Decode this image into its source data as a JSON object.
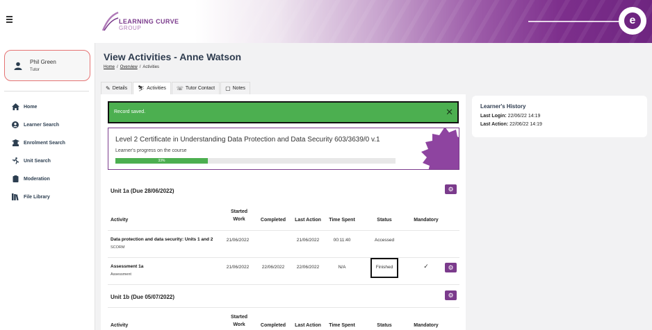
{
  "header": {
    "logo_line1": "LEARNING CURVE",
    "logo_line2": "GROUP",
    "brand_mark": "e",
    "colors": {
      "brand_purple": "#7b3b8c",
      "success_green": "#4caf50"
    }
  },
  "sidebar": {
    "user_name": "Phil Green",
    "user_role": "Tutor",
    "items": [
      {
        "label": "Home",
        "icon": "home-icon"
      },
      {
        "label": "Learner Search",
        "icon": "user-circle-icon"
      },
      {
        "label": "Enrolment Search",
        "icon": "graduation-icon"
      },
      {
        "label": "Unit Search",
        "icon": "unit-icon"
      },
      {
        "label": "Moderation",
        "icon": "clipboard-icon"
      },
      {
        "label": "File Library",
        "icon": "books-icon"
      }
    ]
  },
  "page": {
    "title": "View Activities - Anne Watson",
    "breadcrumb": {
      "home": "Home",
      "overview": "Overview",
      "current": "Activities",
      "separator": "/"
    }
  },
  "tabs": [
    {
      "label": "Details",
      "icon": "pencil-icon"
    },
    {
      "label": "Activities",
      "icon": "activities-icon",
      "active": true
    },
    {
      "label": "Tutor Contact",
      "icon": "contact-icon"
    },
    {
      "label": "Notes",
      "icon": "notes-icon"
    }
  ],
  "alert": {
    "text": "Record saved.",
    "close": "✕"
  },
  "course": {
    "title": "Level 2 Certificate in Understanding Data Protection and Data Security 603/3639/0 v.1",
    "progress_label": "Learner's progress on the course",
    "progress_percent": 33,
    "progress_text": "33%"
  },
  "columns": {
    "activity": "Activity",
    "started_1": "Started",
    "started_2": "Work",
    "completed": "Completed",
    "last_action": "Last Action",
    "time_spent": "Time Spent",
    "status": "Status",
    "mandatory": "Mandatory"
  },
  "units": [
    {
      "title": "Unit 1a (Due 28/06/2022)",
      "rows": [
        {
          "name": "Data protection and data security: Units 1 and 2",
          "type": "SCORM",
          "started": "21/06/2022",
          "completed": "",
          "last_action": "21/06/2022",
          "time_spent": "00:11:40",
          "status": "Accessed",
          "mandatory": ""
        },
        {
          "name": "Assessment 1a",
          "type": "Assessment",
          "started": "21/06/2022",
          "completed": "22/06/2022",
          "last_action": "22/06/2022",
          "time_spent": "N/A",
          "status": "Finished",
          "mandatory": "✓"
        }
      ]
    },
    {
      "title": "Unit 1b (Due 05/07/2022)",
      "rows": []
    }
  ],
  "history": {
    "title": "Learner's History",
    "last_login_label": "Last Login:",
    "last_login": "22/06/22 14:19",
    "last_action_label": "Last Action:",
    "last_action": "22/06/22 14:19"
  }
}
